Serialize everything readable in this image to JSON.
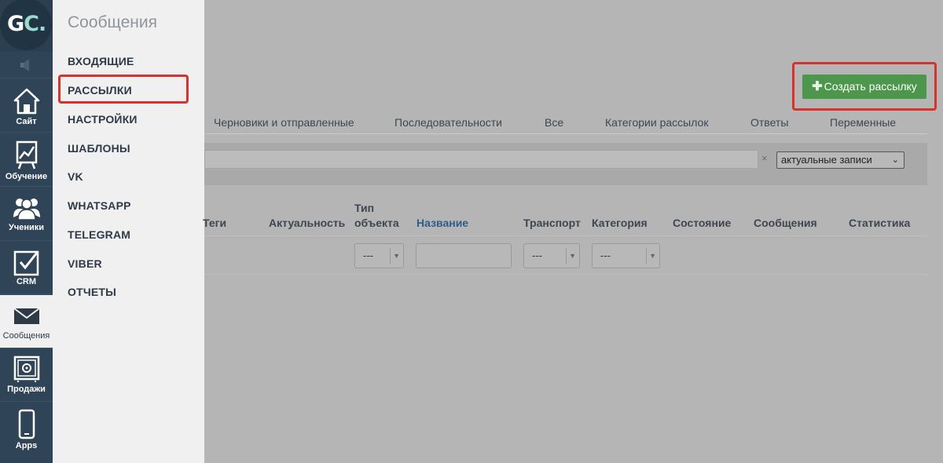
{
  "logo": {
    "text_g": "G",
    "text_c": "C",
    "text_dot": "."
  },
  "rail": {
    "items": [
      {
        "label": "Сайт",
        "icon": "home-icon"
      },
      {
        "label": "Обучение",
        "icon": "chart-board-icon"
      },
      {
        "label": "Ученики",
        "icon": "users-icon"
      },
      {
        "label": "CRM",
        "icon": "checkbox-icon"
      },
      {
        "label": "Сообщения",
        "icon": "envelope-icon"
      },
      {
        "label": "Продажи",
        "icon": "safe-icon"
      },
      {
        "label": "Apps",
        "icon": "phone-icon"
      }
    ]
  },
  "submenu": {
    "title": "Сообщения",
    "items": [
      "ВХОДЯЩИЕ",
      "РАССЫЛКИ",
      "НАСТРОЙКИ",
      "ШАБЛОНЫ",
      "VK",
      "WHATSAPP",
      "TELEGRAM",
      "VIBER",
      "ОТЧЕТЫ"
    ]
  },
  "toolbar": {
    "create_label": "Создать рассылку",
    "create_icon": "plus-icon"
  },
  "tabs": [
    "Черновики и отправленные",
    "Последовательности",
    "Все",
    "Категории рассылок",
    "Ответы",
    "Переменные"
  ],
  "filters": {
    "clear": "×",
    "status_value": "актуальные записи",
    "status_caret": "⌄"
  },
  "table": {
    "headers": {
      "tags": "Теги",
      "actuality": "Актуальность",
      "object_type_1": "Тип",
      "object_type_2": "объекта",
      "name": "Название",
      "transport": "Транспорт",
      "category": "Категория",
      "state": "Состояние",
      "messages": "Сообщения",
      "stats": "Статистика"
    },
    "filter_placeholder": "---",
    "select_caret": "▼"
  },
  "highlight_color": "#d8322e",
  "accent_green": "#4c974b"
}
